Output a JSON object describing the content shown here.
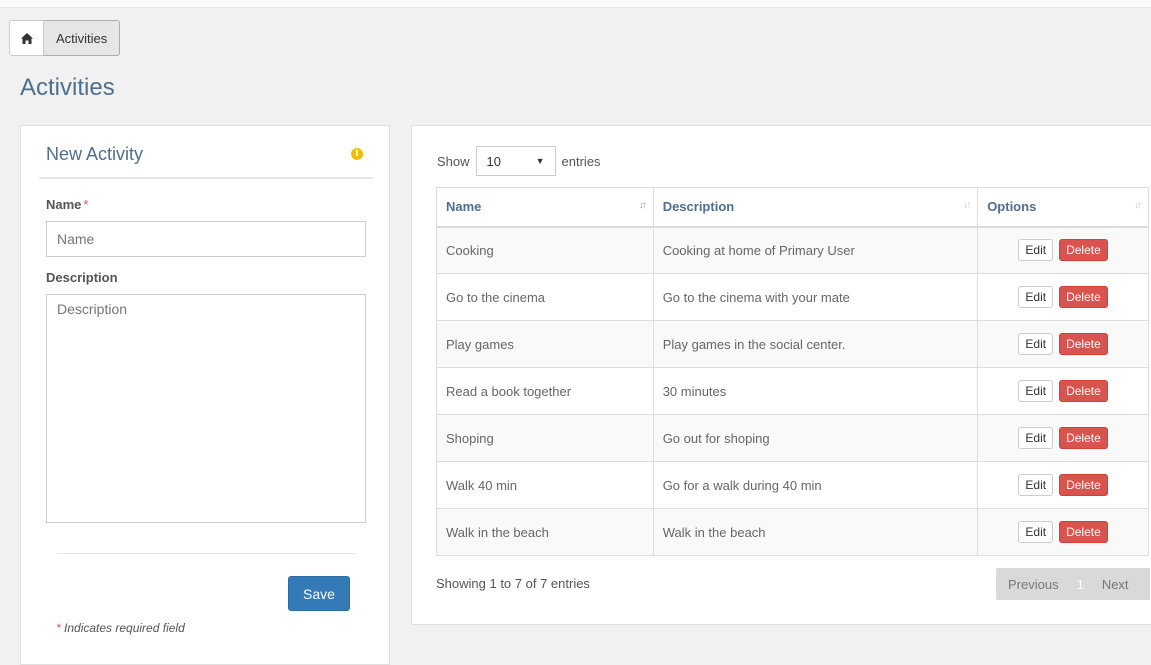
{
  "breadcrumb": {
    "home_icon": "home-icon",
    "current": "Activities"
  },
  "page_title": "Activities",
  "form": {
    "title": "New Activity",
    "info_icon": "info-icon",
    "name_label": "Name",
    "required_mark": "*",
    "name_placeholder": "Name",
    "description_label": "Description",
    "description_placeholder": "Description",
    "save_label": "Save",
    "required_note": "* Indicates required field"
  },
  "table": {
    "show_label": "Show",
    "entries_value": "10",
    "entries_label": "entries",
    "columns": [
      "Name",
      "Description",
      "Options"
    ],
    "rows": [
      {
        "name": "Cooking",
        "description": "Cooking at home of Primary User"
      },
      {
        "name": "Go to the cinema",
        "description": "Go to the cinema with your mate"
      },
      {
        "name": "Play games",
        "description": "Play games in the social center."
      },
      {
        "name": "Read a book together",
        "description": "30 minutes"
      },
      {
        "name": "Shoping",
        "description": "Go out for shoping"
      },
      {
        "name": "Walk 40 min",
        "description": "Go for a walk during 40 min"
      },
      {
        "name": "Walk in the beach",
        "description": "Walk in the beach"
      }
    ],
    "edit_label": "Edit",
    "delete_label": "Delete",
    "info": "Showing 1 to 7 of 7 entries",
    "pagination": {
      "previous": "Previous",
      "page": "1",
      "next": "Next"
    }
  },
  "colors": {
    "accent": "#4f6f8d",
    "primary_button": "#337ab7",
    "danger_button": "#d9534f",
    "info_icon": "#f0c000"
  }
}
